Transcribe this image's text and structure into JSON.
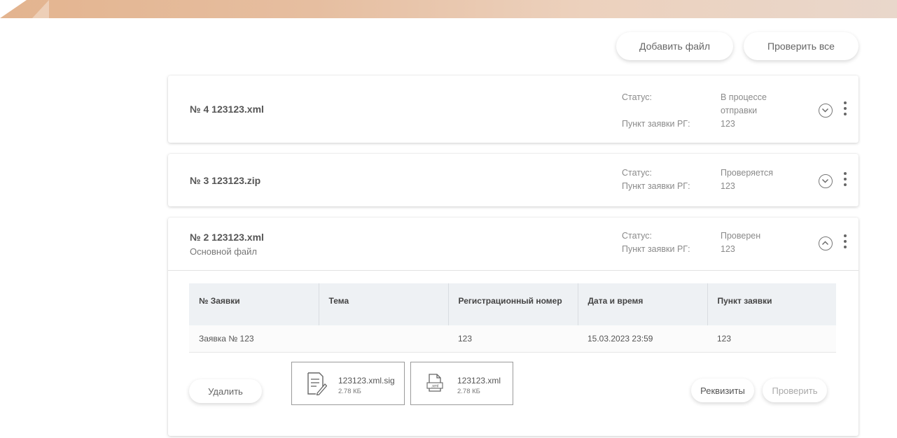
{
  "toolbar": {
    "add_file_label": "Добавить файл",
    "check_all_label": "Проверить все"
  },
  "cards": [
    {
      "title": "№ 4  123123.xml",
      "status_label": "Статус:",
      "status_value_line1": "В процессе",
      "status_value_line2": "отправки",
      "point_label": "Пункт заявки РГ:",
      "point_value": "123",
      "expanded": false
    },
    {
      "title": "№ 3  123123.zip",
      "status_label": "Статус:",
      "status_value": "Проверяется",
      "point_label": "Пункт заявки РГ:",
      "point_value": "123",
      "expanded": false
    },
    {
      "title": "№ 2  123123.xml",
      "subtitle": "Основной файл",
      "status_label": "Статус:",
      "status_value": "Проверен",
      "point_label": "Пункт заявки РГ:",
      "point_value": "123",
      "expanded": true,
      "table": {
        "headers": [
          "№ Заявки",
          "Тема",
          "Регистрационный номер",
          "Дата и время",
          "Пункт заявки"
        ],
        "rows": [
          [
            "Заявка № 123",
            "",
            "123",
            "15.03.2023 23:59",
            "123"
          ]
        ]
      },
      "files": [
        {
          "name": "123123.xml.sig",
          "size": "2.78 КБ",
          "icon": "signed-document-icon"
        },
        {
          "name": "123123.xml",
          "size": "2.78 КБ",
          "icon": "xml-file-icon",
          "badge": ".xml"
        }
      ],
      "delete_label": "Удалить",
      "details_label": "Реквизиты",
      "check_label": "Проверить"
    }
  ]
}
